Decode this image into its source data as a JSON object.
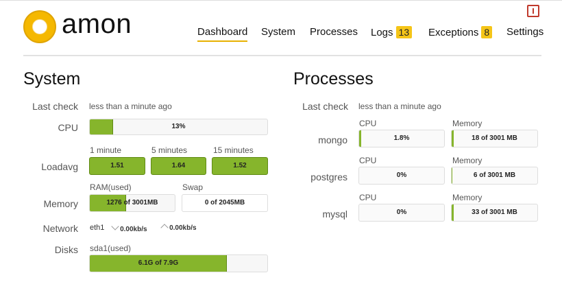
{
  "header": {
    "logo_text": "amon",
    "nav": [
      {
        "label": "Dashboard"
      },
      {
        "label": "System"
      },
      {
        "label": "Processes"
      },
      {
        "label": "Logs",
        "badge": "13"
      },
      {
        "label": "Exceptions",
        "badge": "8"
      },
      {
        "label": "Settings"
      }
    ]
  },
  "system": {
    "title": "System",
    "last_check_label": "Last check",
    "last_check_value": "less than a minute ago",
    "cpu_label": "CPU",
    "cpu_value": "13%",
    "cpu_fraction": 0.13,
    "loadavg_label": "Loadavg",
    "loadavg": [
      {
        "period": "1 minute",
        "value": "1.51"
      },
      {
        "period": "5 minutes",
        "value": "1.64"
      },
      {
        "period": "15 minutes",
        "value": "1.52"
      }
    ],
    "memory_label": "Memory",
    "ram_label": "RAM(used)",
    "ram_value": "1276 of 3001MB",
    "ram_fraction": 0.425,
    "swap_label": "Swap",
    "swap_value": "0 of 2045MB",
    "network_label": "Network",
    "network_iface": "eth1",
    "network_in": "0.00kb/s",
    "network_out": "0.00kb/s",
    "disks_label": "Disks",
    "disk_name": "sda1(used)",
    "disk_value": "6.1G of 7.9G",
    "disk_fraction": 0.772
  },
  "processes": {
    "title": "Processes",
    "last_check_label": "Last check",
    "last_check_value": "less than a minute ago",
    "cpu_header": "CPU",
    "memory_header": "Memory",
    "items": [
      {
        "name": "mongo",
        "cpu": "1.8%",
        "cpu_fraction": 0.018,
        "memory": "18 of 3001 MB",
        "memory_fraction": 0.006
      },
      {
        "name": "postgres",
        "cpu": "0%",
        "cpu_fraction": 0.0,
        "memory": "6 of 3001 MB",
        "memory_fraction": 0.002
      },
      {
        "name": "mysql",
        "cpu": "0%",
        "cpu_fraction": 0.0,
        "memory": "33 of 3001 MB",
        "memory_fraction": 0.011
      }
    ]
  },
  "colors": {
    "accent": "#f5c518",
    "bar_fill": "#86b52c",
    "alert": "#c0392b"
  }
}
